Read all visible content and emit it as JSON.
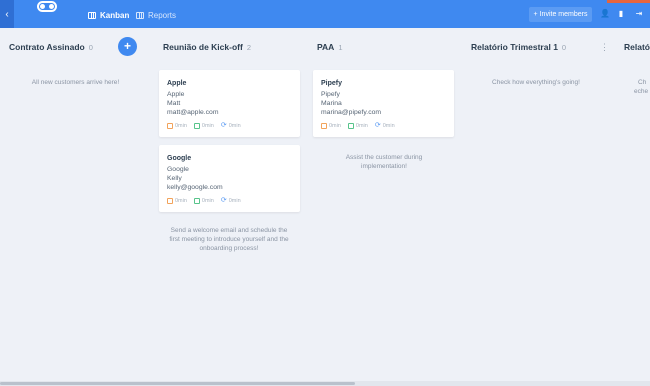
{
  "topbar": {
    "nav": [
      {
        "label": "Kanban",
        "icon": "kanban-icon"
      },
      {
        "label": "Reports",
        "icon": "reports-icon"
      }
    ],
    "invite_label": "Invite members",
    "accent": "#3f89f0"
  },
  "columns": [
    {
      "title": "Contrato Assinado",
      "count": "0",
      "hint": "All new customers arrive here!"
    },
    {
      "title": "Reunião de Kick-off",
      "count": "2",
      "hint": "Send a welcome email and schedule the first meeting to introduce yourself and the onboarding process!"
    },
    {
      "title": "PAA",
      "count": "1",
      "hint": "Assist the customer during implementation!"
    },
    {
      "title": "Relatório Trimestral 1",
      "count": "0",
      "hint": "Check how everything's going!"
    },
    {
      "title": "Relatór",
      "count": "",
      "hint": "Ch",
      "hint2": "eche"
    }
  ],
  "cards": [
    {
      "title": "Apple",
      "company": "Apple",
      "contact": "Matt",
      "email": "matt@apple.com",
      "t1": "0min",
      "t2": "0min",
      "t3": "0min"
    },
    {
      "title": "Google",
      "company": "Google",
      "contact": "Kelly",
      "email": "kelly@google.com",
      "t1": "0min",
      "t2": "0min",
      "t3": "0min"
    },
    {
      "title": "Pipefy",
      "company": "Pipefy",
      "contact": "Marina",
      "email": "marina@pipefy.com",
      "t1": "0min",
      "t2": "0min",
      "t3": "0min"
    }
  ],
  "add_label": "+",
  "kebab_label": "⋮",
  "back_label": "‹"
}
